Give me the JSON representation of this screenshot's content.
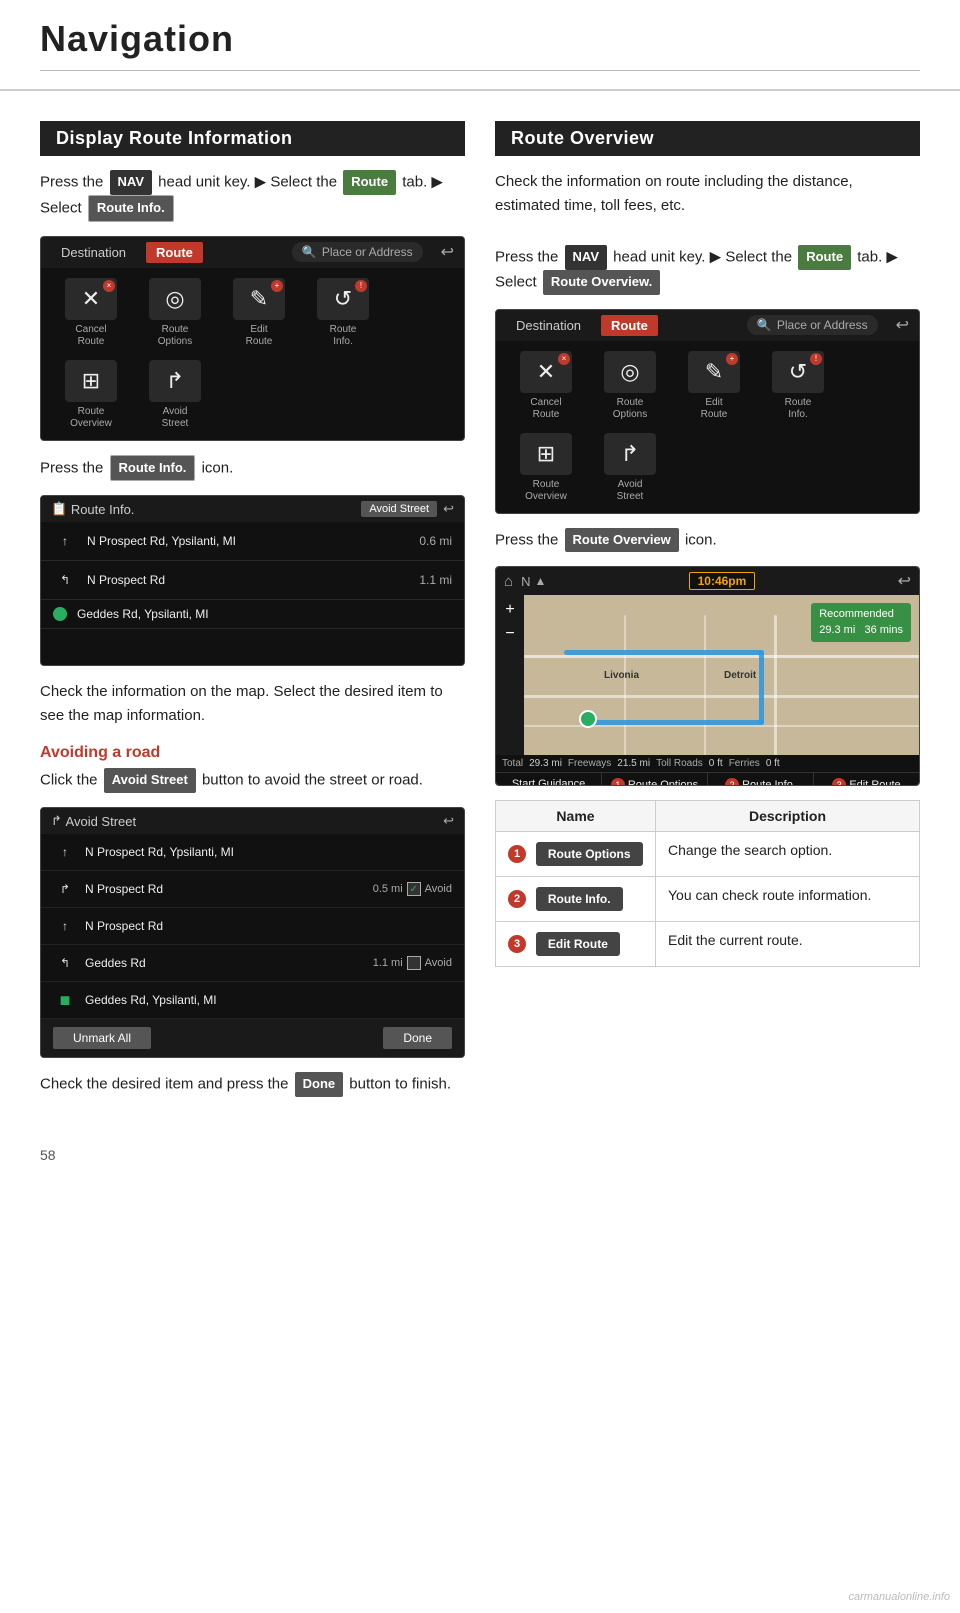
{
  "header": {
    "title": "Navigation"
  },
  "left_section": {
    "title": "Display Route Information",
    "intro": [
      "Press the",
      "NAV",
      "head unit key. ▶ Select the",
      "Route",
      "tab. ▶ Select",
      "Route Info."
    ],
    "screen1": {
      "tab_destination": "Destination",
      "tab_route": "Route",
      "search_placeholder": "Place or Address",
      "icons": [
        {
          "label": "Cancel\nRoute",
          "symbol": "✕",
          "badge": true
        },
        {
          "label": "Route\nOptions",
          "symbol": "◎",
          "badge": false
        },
        {
          "label": "Edit\nRoute",
          "symbol": "✎",
          "badge": true
        },
        {
          "label": "Route\nInfo.",
          "symbol": "↺",
          "badge": true
        },
        {
          "label": "Route\nOverview",
          "symbol": "⊞",
          "badge": false
        },
        {
          "label": "Avoid\nStreet",
          "symbol": "↱",
          "badge": false
        }
      ]
    },
    "press_icon_text": "Press the",
    "press_icon_badge": "Route Info.",
    "press_icon_suffix": "icon.",
    "routeinfo_screen": {
      "title": "Route Info.",
      "avoid_btn": "Avoid Street",
      "rows": [
        {
          "type": "turn",
          "arrow": "↑",
          "street": "N Prospect Rd, Ypsilanti, MI",
          "dist": "0.6 mi"
        },
        {
          "type": "turn",
          "arrow": "↰",
          "street": "N Prospect Rd",
          "dist": "1.1 mi"
        },
        {
          "type": "dest",
          "street": "Geddes Rd, Ypsilanti, MI",
          "dist": ""
        }
      ]
    },
    "check_info_text": "Check the information on the map. Select the desired item to see the map information.",
    "avoiding_road_title": "Avoiding a road",
    "avoiding_road_text": [
      "Click the",
      "Avoid Street",
      "button to avoid the street or road."
    ],
    "avoid_screen": {
      "title": "Avoid Street",
      "rows": [
        {
          "arrow": "↑",
          "street": "N Prospect Rd, Ypsilanti, MI",
          "dist": "",
          "avoid": false
        },
        {
          "arrow": "↱",
          "street": "N Prospect Rd",
          "dist": "0.5 mi",
          "avoid": true
        },
        {
          "arrow": "↑",
          "street": "N Prospect Rd",
          "dist": "",
          "avoid": false
        },
        {
          "arrow": "↰",
          "street": "Geddes Rd",
          "dist": "1.1 mi",
          "avoid": false
        },
        {
          "arrow": "●",
          "street": "Geddes Rd, Ypsilanti, MI",
          "dist": "",
          "avoid": false,
          "dest": true
        }
      ],
      "unmark_all": "Unmark All",
      "done": "Done"
    },
    "check_press_done_text": "Check the desired item and press the",
    "done_badge": "Done",
    "done_suffix": "button to finish."
  },
  "right_section": {
    "title": "Route Overview",
    "intro_text": "Check the information on route including the distance, estimated time, toll fees, etc.",
    "press_lines": [
      "Press the",
      "NAV",
      "head unit key. ▶ Select the",
      "Route",
      "tab. ▶ Select",
      "Route Overview."
    ],
    "screen2": {
      "tab_destination": "Destination",
      "tab_route": "Route",
      "icons": [
        {
          "label": "Cancel\nRoute",
          "symbol": "✕",
          "badge": true
        },
        {
          "label": "Route\nOptions",
          "symbol": "◎",
          "badge": false
        },
        {
          "label": "Edit\nRoute",
          "symbol": "✎",
          "badge": true
        },
        {
          "label": "Route\nInfo.",
          "symbol": "↺",
          "badge": true
        },
        {
          "label": "Route\nOverview",
          "symbol": "⊞",
          "badge": false
        },
        {
          "label": "Avoid\nStreet",
          "symbol": "↱",
          "badge": false
        }
      ]
    },
    "press_routeoverview": "Press the",
    "routeoverview_badge": "Route Overview",
    "press_icon_suffix": "icon.",
    "map_time": "10:46pm",
    "map_recommended": "Recommended",
    "map_rec_dist": "29.3 mi",
    "map_rec_time": "36 mins",
    "map_stats": {
      "total_label": "Total",
      "total_val": "29.3 mi",
      "freeways_label": "Freeways",
      "freeways_val": "21.5 mi",
      "toll_label": "Toll Roads",
      "toll_val": "0 ft",
      "ferries_label": "Ferries",
      "ferries_val": "0 ft"
    },
    "map_btns": [
      {
        "num": "",
        "label": "Start Guidance"
      },
      {
        "num": "1",
        "label": "Route Options"
      },
      {
        "num": "2",
        "label": "Route Info."
      },
      {
        "num": "3",
        "label": "Edit Route"
      }
    ],
    "table": {
      "col1": "Name",
      "col2": "Description",
      "rows": [
        {
          "num": "1",
          "btn_label": "Route Options",
          "description": "Change the search option."
        },
        {
          "num": "2",
          "btn_label": "Route Info.",
          "description": "You can check route information."
        },
        {
          "num": "3",
          "btn_label": "Edit Route",
          "description": "Edit the current route."
        }
      ]
    }
  },
  "footer": {
    "page_num": "58",
    "watermark": "carmanualonline.info"
  }
}
